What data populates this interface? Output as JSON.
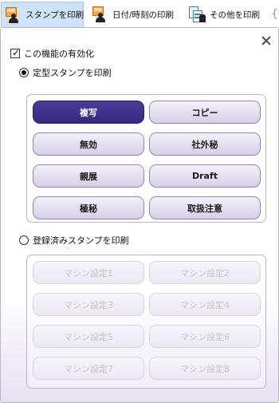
{
  "tabs": [
    {
      "label": "スタンプを印刷",
      "icon": "stamp-print-icon",
      "active": true
    },
    {
      "label": "日付/時刻の印刷",
      "icon": "date-time-print-icon",
      "active": false
    },
    {
      "label": "その他を印刷",
      "icon": "other-print-icon",
      "active": false
    }
  ],
  "tab_overflow_glyph": "{",
  "panel": {
    "close_glyph": "×",
    "enable_label": "この機能の有効化",
    "enable_checked": true,
    "fixed_stamp_label": "定型スタンプを印刷",
    "fixed_stamp_selected": true,
    "fixed_stamps": [
      "複写",
      "コピー",
      "無効",
      "社外秘",
      "親展",
      "Draft",
      "極秘",
      "取扱注意"
    ],
    "selected_stamp": "複写",
    "registered_stamp_label": "登録済みスタンプを印刷",
    "registered_stamp_selected": false,
    "registered_stamps": [
      "マシン設定1",
      "マシン設定2",
      "マシン設定3",
      "マシン設定4",
      "マシン設定5",
      "マシン設定6",
      "マシン設定7",
      "マシン設定8"
    ]
  },
  "colors": {
    "active_tab": "#cfe3f7",
    "selected_button": "#3f3190",
    "button_gradient_top": "#f4f1fb",
    "button_gradient_bottom": "#d6cfe8"
  }
}
